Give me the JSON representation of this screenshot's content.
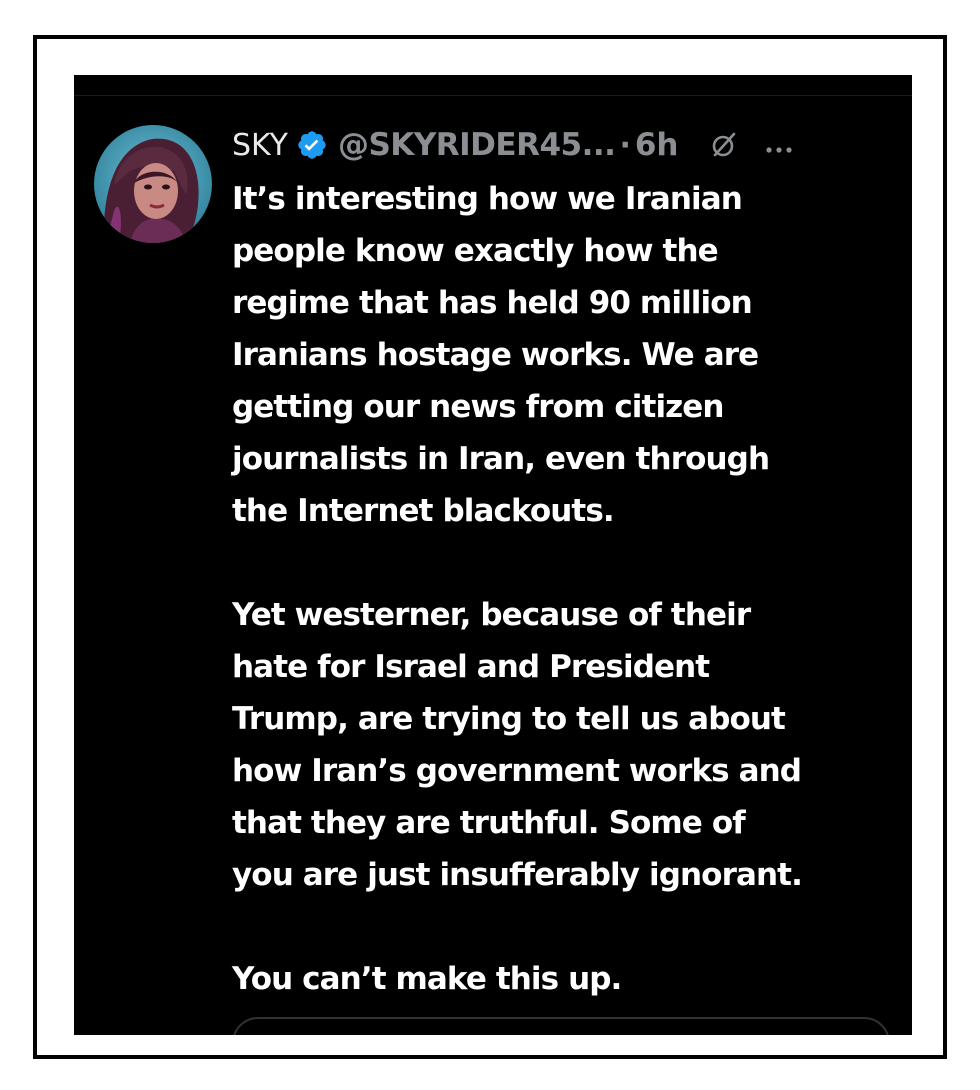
{
  "post": {
    "display_name": "SKY",
    "handle": "@SKYRIDER45...",
    "separator": "·",
    "timestamp": "6h",
    "verified_icon": "verified-badge-icon",
    "grok_icon": "grok-icon",
    "more_icon": "more-options-icon",
    "paragraphs": [
      [
        "It’s interesting how we Iranian",
        "people know exactly how the",
        "regime that has held 90 million",
        "Iranians hostage works. We are",
        "getting our news from citizen",
        "journalists in Iran, even through",
        "the Internet blackouts."
      ],
      [
        "Yet westerner, because of their",
        "hate for Israel and President",
        "Trump, are trying to tell us about",
        "how Iran’s government works and",
        "that they are truthful. Some of",
        "you are just insufferably ignorant."
      ],
      [
        "You can’t make this up."
      ]
    ]
  },
  "colors": {
    "background": "#000000",
    "text": "#ffffff",
    "secondary_text": "#8b8f94",
    "verified_blue": "#1d9bf0",
    "frame_border": "#000000"
  }
}
